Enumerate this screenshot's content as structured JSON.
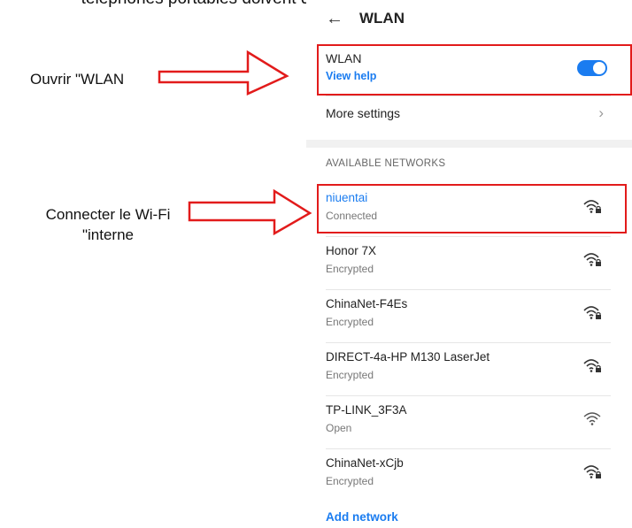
{
  "document": {
    "header_text": "téléphones portables doivent d'abord être connectés au réseau"
  },
  "topbar": {
    "back_icon": "arrow-left-icon",
    "title": "WLAN"
  },
  "wlan_toggle": {
    "label": "WLAN",
    "help_link": "View help",
    "state": "on",
    "accent_color": "#1a7cf0"
  },
  "more_settings": {
    "label": "More settings",
    "icon": "chevron-right-icon"
  },
  "available_networks": {
    "title": "AVAILABLE NETWORKS",
    "items": [
      {
        "name": "niuentai",
        "status": "Connected",
        "icon": "wifi-locked-icon",
        "connected": true
      },
      {
        "name": "Honor 7X",
        "status": "Encrypted",
        "icon": "wifi-locked-icon",
        "connected": false
      },
      {
        "name": "ChinaNet-F4Es",
        "status": "Encrypted",
        "icon": "wifi-locked-icon",
        "connected": false
      },
      {
        "name": "DIRECT-4a-HP M130 LaserJet",
        "status": "Encrypted",
        "icon": "wifi-locked-icon",
        "connected": false
      },
      {
        "name": "TP-LINK_3F3A",
        "status": "Open",
        "icon": "wifi-open-icon",
        "connected": false
      },
      {
        "name": "ChinaNet-xCjb",
        "status": "Encrypted",
        "icon": "wifi-locked-icon",
        "connected": false
      }
    ]
  },
  "add_network": {
    "label": "Add network"
  },
  "annotations": {
    "open_wlan": "Ouvrir \"WLAN",
    "connect_wifi_line1": "Connecter le Wi-Fi",
    "connect_wifi_line2": "\"interne",
    "highlight_color": "#e21b1b"
  }
}
